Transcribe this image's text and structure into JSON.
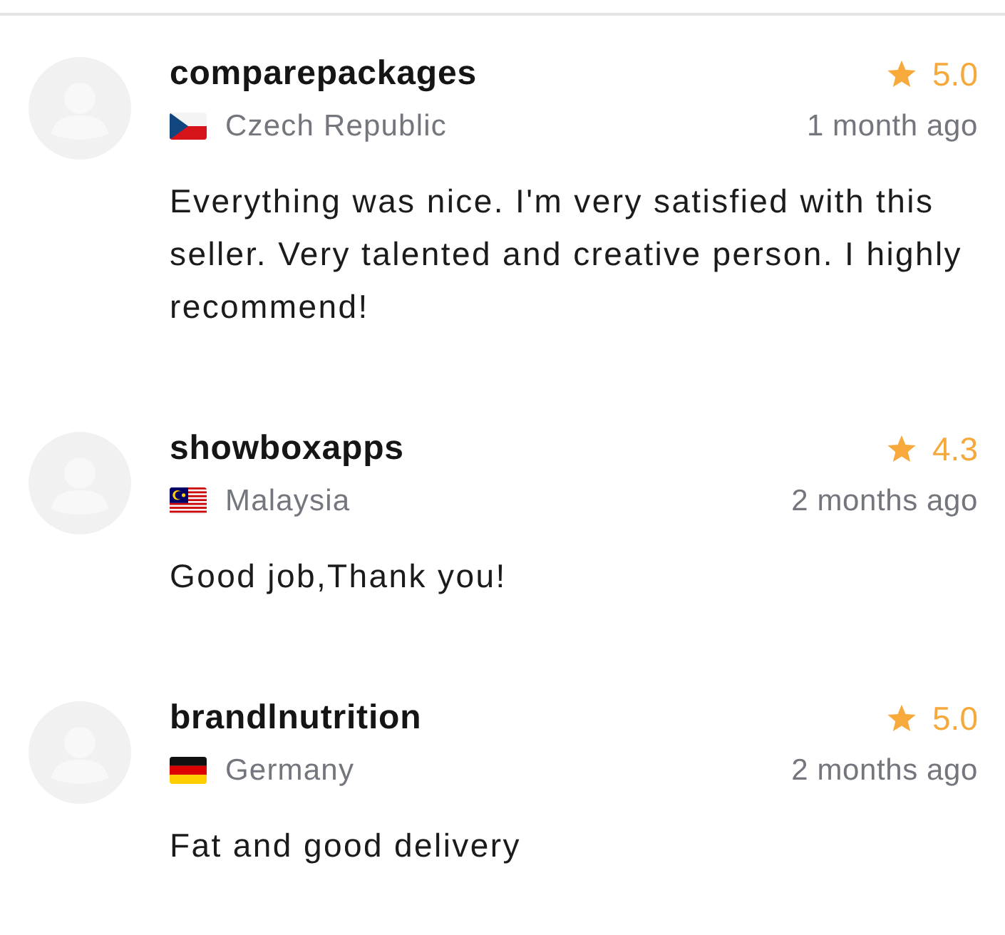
{
  "reviews": [
    {
      "username": "comparepackages",
      "flag": {
        "kind": "czech"
      },
      "country": "Czech Republic",
      "rating": "5.0",
      "time": "1 month ago",
      "text": "Everything was nice. I'm very satisfied with this seller. Very talented and creative person. I highly recommend!"
    },
    {
      "username": "showboxapps",
      "flag": {
        "kind": "malaysian"
      },
      "country": "Malaysia",
      "rating": "4.3",
      "time": "2 months ago",
      "text": "Good job,Thank you!"
    },
    {
      "username": "brandlnutrition",
      "flag": {
        "kind": "german"
      },
      "country": "Germany",
      "rating": "5.0",
      "time": "2 months ago",
      "text": "Fat and good delivery"
    }
  ]
}
